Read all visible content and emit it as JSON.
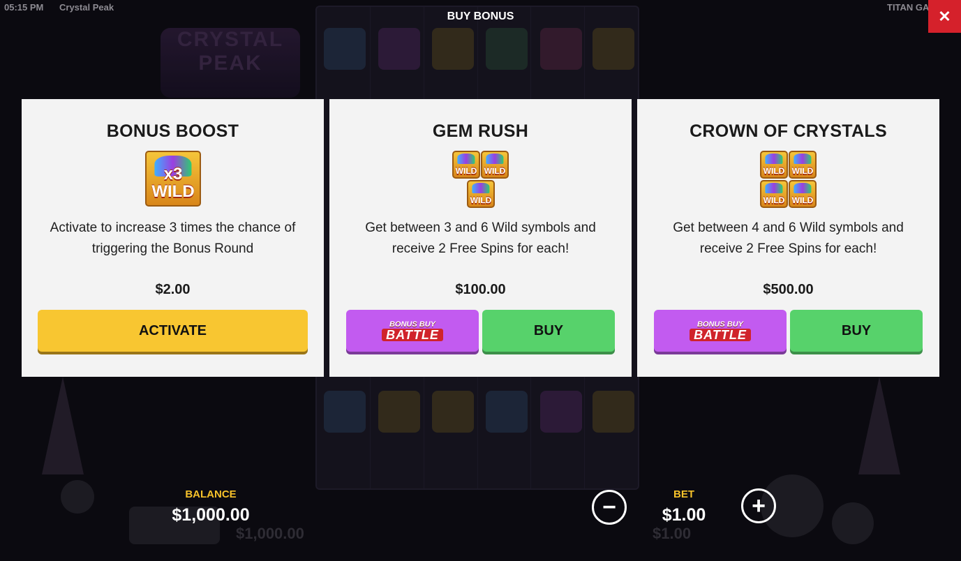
{
  "topbar": {
    "time": "05:15 PM",
    "game_name": "Crystal Peak",
    "provider": "TITAN GA",
    "modal_title": "BUY BONUS",
    "close_glyph": "✕"
  },
  "cards": [
    {
      "title": "BONUS BOOST",
      "icon": "x3-wild-icon",
      "icon_multiplier": "x3",
      "icon_text": "WILD",
      "description": "Activate to increase 3 times the chance of triggering the Bonus Round",
      "price": "$2.00",
      "button_label": "ACTIVATE"
    },
    {
      "title": "GEM RUSH",
      "icon": "wild-symbols-icon",
      "icon_text": "WILD",
      "description": "Get between 3 and 6 Wild symbols and receive 2 Free Spins for each!",
      "price": "$100.00",
      "battle_top": "BONUS BUY",
      "battle_bottom": "BATTLE",
      "button_label": "BUY"
    },
    {
      "title": "CROWN OF CRYSTALS",
      "icon": "wild-symbols-icon",
      "icon_text": "WILD",
      "description": "Get between 4 and 6 Wild symbols and receive 2 Free Spins for each!",
      "price": "$500.00",
      "battle_top": "BONUS BUY",
      "battle_bottom": "BATTLE",
      "button_label": "BUY"
    }
  ],
  "footer": {
    "balance_label": "BALANCE",
    "balance_value": "$1,000.00",
    "bet_label": "BET",
    "bet_value": "$1.00",
    "minus_glyph": "−",
    "plus_glyph": "+"
  },
  "colors": {
    "accent_yellow": "#f8c631",
    "buy_green": "#57d26b",
    "battle_purple": "#c25bf0",
    "close_red": "#d5212b",
    "label_gold": "#f7c22a"
  }
}
